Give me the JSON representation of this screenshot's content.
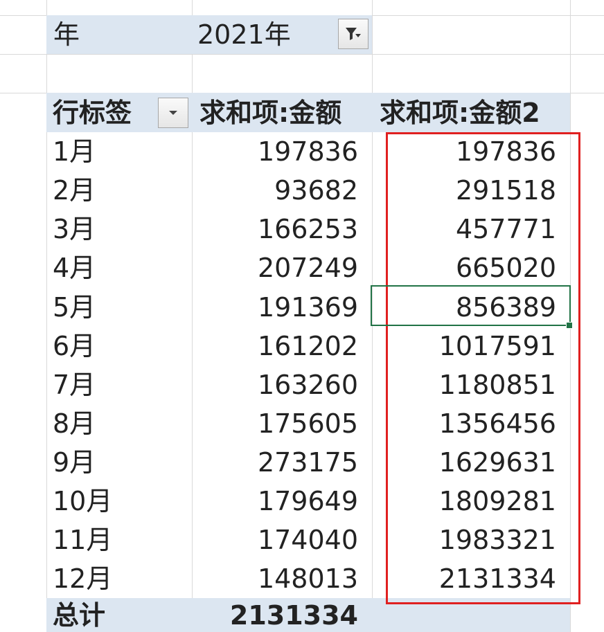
{
  "filter": {
    "field_label": "年",
    "field_value": "2021年",
    "button_icon": "filter-funnel-icon"
  },
  "pivot": {
    "headers": {
      "row_label": "行标签",
      "sum_amount": "求和项:金额",
      "sum_amount2": "求和项:金额2",
      "row_label_icon": "chevron-down-icon"
    },
    "rows": [
      {
        "month": "1月",
        "amount": "197836",
        "amount2": "197836"
      },
      {
        "month": "2月",
        "amount": "93682",
        "amount2": "291518"
      },
      {
        "month": "3月",
        "amount": "166253",
        "amount2": "457771"
      },
      {
        "month": "4月",
        "amount": "207249",
        "amount2": "665020"
      },
      {
        "month": "5月",
        "amount": "191369",
        "amount2": "856389"
      },
      {
        "month": "6月",
        "amount": "161202",
        "amount2": "1017591"
      },
      {
        "month": "7月",
        "amount": "163260",
        "amount2": "1180851"
      },
      {
        "month": "8月",
        "amount": "175605",
        "amount2": "1356456"
      },
      {
        "month": "9月",
        "amount": "273175",
        "amount2": "1629631"
      },
      {
        "month": "10月",
        "amount": "179649",
        "amount2": "1809281"
      },
      {
        "month": "11月",
        "amount": "174040",
        "amount2": "1983321"
      },
      {
        "month": "12月",
        "amount": "148013",
        "amount2": "2131334"
      }
    ],
    "total": {
      "label": "总计",
      "amount": "2131334"
    }
  },
  "colors": {
    "pivot_header_fill": "#dce6f1",
    "highlight_box": "#e02020",
    "active_cell_border": "#217346",
    "gridline": "#d9d9d9"
  }
}
